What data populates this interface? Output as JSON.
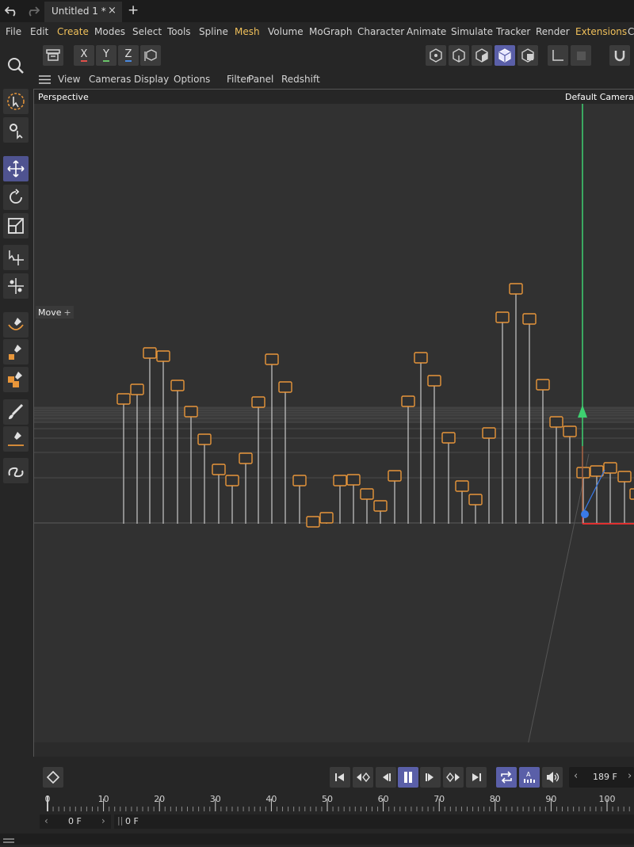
{
  "tabbar": {
    "tab_title": "Untitled 1 *",
    "close_glyph": "×",
    "new_tab_glyph": "+"
  },
  "menu": {
    "items": [
      {
        "label": "File",
        "highlight": false
      },
      {
        "label": "Edit",
        "highlight": false
      },
      {
        "label": "Create",
        "highlight": true
      },
      {
        "label": "Modes",
        "highlight": false
      },
      {
        "label": "Select",
        "highlight": false
      },
      {
        "label": "Tools",
        "highlight": false
      },
      {
        "label": "Spline",
        "highlight": false
      },
      {
        "label": "Mesh",
        "highlight": true
      },
      {
        "label": "Volume",
        "highlight": false
      },
      {
        "label": "MoGraph",
        "highlight": false
      },
      {
        "label": "Character",
        "highlight": false
      },
      {
        "label": "Animate",
        "highlight": false
      },
      {
        "label": "Simulate",
        "highlight": false
      },
      {
        "label": "Tracker",
        "highlight": false
      },
      {
        "label": "Render",
        "highlight": false
      },
      {
        "label": "Extensions",
        "highlight": true
      },
      {
        "label": "Co",
        "highlight": false
      }
    ]
  },
  "toolbar": {
    "axis_x": "X",
    "axis_y": "Y",
    "axis_z": "Z",
    "colors": {
      "x": "#e0504a",
      "y": "#6ac46a",
      "z": "#4a8ae0"
    }
  },
  "viewport_menu": {
    "items": [
      "View",
      "Cameras",
      "Display",
      "Options",
      "Filter",
      "Panel",
      "Redshift"
    ]
  },
  "viewport": {
    "projection_label": "Perspective",
    "camera_label": "Default Camera ◦̈",
    "tool_label": "Move",
    "tool_glyph": "+",
    "accent_color": "#e8963a",
    "axis_colors": {
      "x": "#e03030",
      "y": "#3ed070",
      "z": "#3a7ae8"
    }
  },
  "timeline": {
    "current_frame": "189 F",
    "start_frame": "0 F",
    "range_label": "0 F",
    "ruler_labels": [
      "0",
      "10",
      "20",
      "30",
      "40",
      "50",
      "60",
      "70",
      "80",
      "90",
      "100"
    ],
    "accent_color": "#5a5fa8"
  }
}
